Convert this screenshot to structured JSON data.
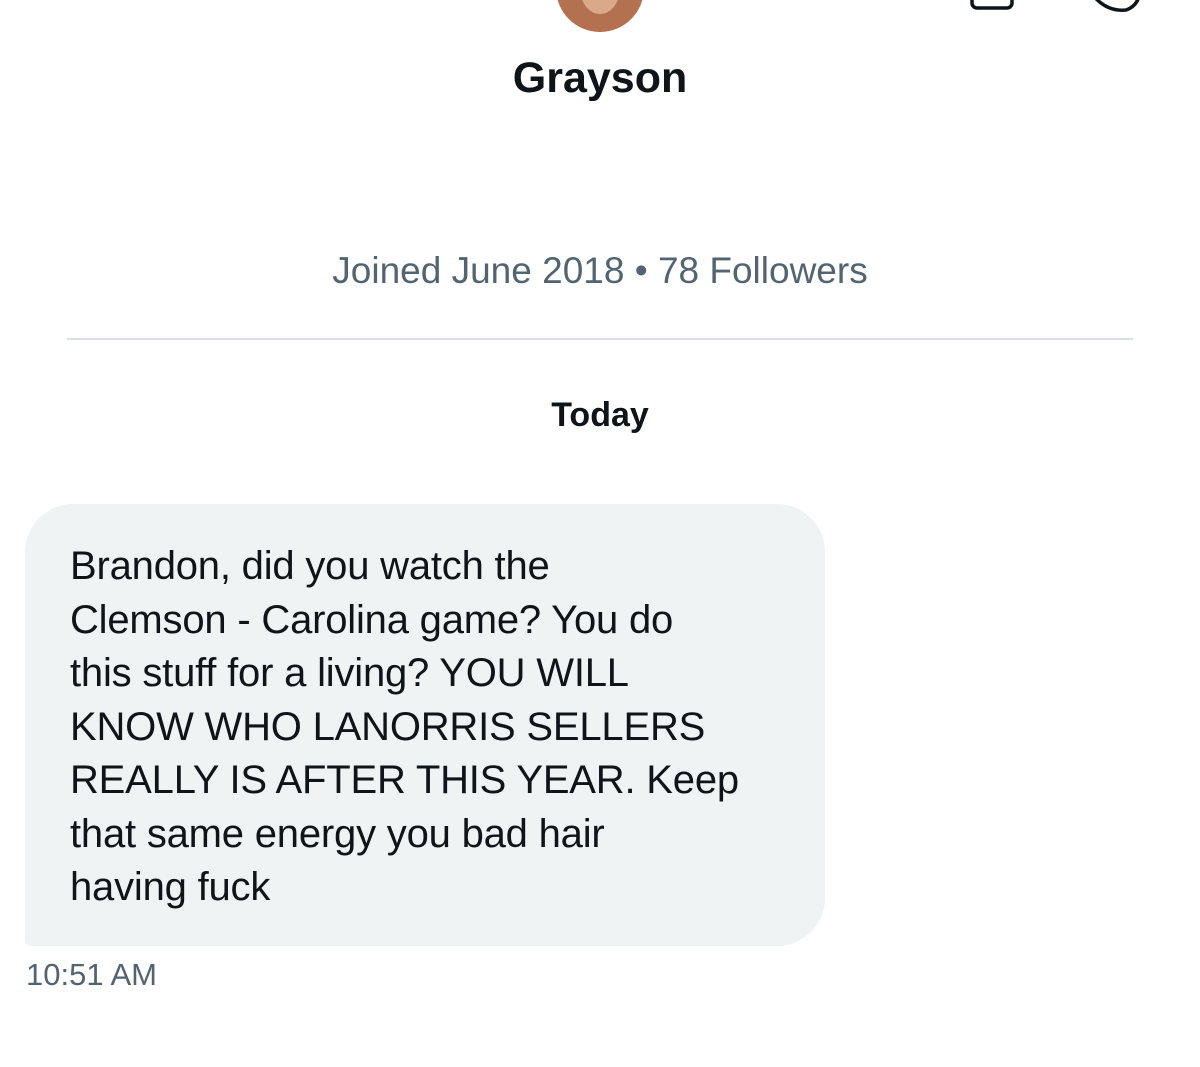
{
  "header": {
    "back_icon": "chevron-left-icon",
    "avatar_icon": "profile-photo",
    "camera_icon": "video-camera-icon",
    "info_icon": "info-icon"
  },
  "profile": {
    "name": "Grayson",
    "meta": "Joined June 2018 • 78 Followers"
  },
  "conversation": {
    "date_label": "Today",
    "messages": [
      {
        "text": "Brandon, did you watch the\nClemson - Carolina game? You do\nthis stuff for a living? YOU WILL\nKNOW WHO LANORRIS SELLERS\nREALLY IS AFTER THIS YEAR. Keep\nthat same energy you bad hair\nhaving fuck",
        "time": "10:51 AM"
      }
    ]
  },
  "colors": {
    "text_primary": "#0f1419",
    "text_secondary": "#536471",
    "bubble_background": "#eff3f4",
    "divider": "#d9dfe4"
  }
}
